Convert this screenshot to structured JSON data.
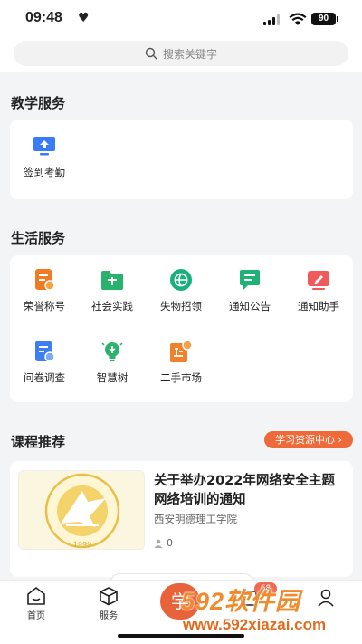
{
  "status_bar": {
    "time": "09:48",
    "battery": "90"
  },
  "search": {
    "placeholder": "搜索关键字"
  },
  "teaching": {
    "title": "教学服务",
    "items": [
      {
        "label": "签到考勤",
        "icon": "checkin-monitor-icon",
        "color": "#3b7bf6"
      }
    ]
  },
  "life": {
    "title": "生活服务",
    "items": [
      {
        "label": "荣誉称号",
        "icon": "honor-document-icon",
        "color": "#f07b22"
      },
      {
        "label": "社会实践",
        "icon": "practice-folder-icon",
        "color": "#27b36b"
      },
      {
        "label": "失物招领",
        "icon": "lost-found-ball-icon",
        "color": "#19b07d"
      },
      {
        "label": "通知公告",
        "icon": "notice-chat-icon",
        "color": "#1fb276"
      },
      {
        "label": "通知助手",
        "icon": "notify-assistant-icon",
        "color": "#f05a5a"
      },
      {
        "label": "问卷调查",
        "icon": "survey-document-icon",
        "color": "#3d7ff2"
      },
      {
        "label": "智慧树",
        "icon": "smart-tree-bulb-icon",
        "color": "#2bb36e"
      },
      {
        "label": "二手市场",
        "icon": "second-hand-market-icon",
        "color": "#f0802a"
      }
    ]
  },
  "courses": {
    "title": "课程推荐",
    "link_label": "学习资源中心 ›",
    "items": [
      {
        "title": "关于举办2022年网络安全主题网络培训的通知",
        "school": "西安明德理工学院",
        "count": "0"
      }
    ]
  },
  "tabbar": {
    "tabs": [
      {
        "label": "首页"
      },
      {
        "label": "服务"
      }
    ],
    "center_glyph": "学",
    "badge": "68"
  },
  "watermark": {
    "brand": "592软件园",
    "url": "www.592xiazai.com"
  },
  "colors": {
    "accent": "#ee6a3a",
    "background": "#f3f4f6"
  }
}
